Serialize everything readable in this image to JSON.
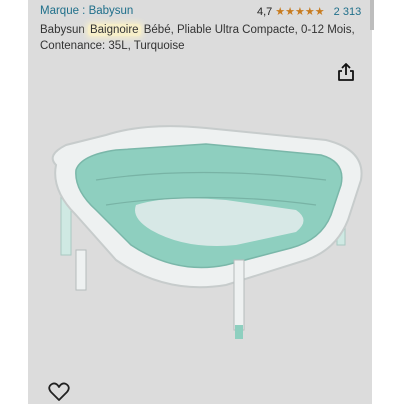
{
  "product": {
    "brand": "Marque : Babysun",
    "title_before": "Babysun ",
    "title_highlight": "Baignoire",
    "title_after": " Bébé, Pliable Ultra Compacte, 0-12 Mois, Contenance: 35L, Turquoise",
    "image_alt": "Baignoire pliable turquoise",
    "colors": {
      "tub_inner": "#8ecfbf",
      "tub_rim": "#eef1f1",
      "background": "#dcdcdc"
    }
  },
  "rating": {
    "value": "4,7",
    "stars": 4.7,
    "stars_max": 5,
    "count": "2 313",
    "star_color": "#c87b1e"
  },
  "icons": {
    "share": "share-icon",
    "favorite": "heart-icon"
  }
}
